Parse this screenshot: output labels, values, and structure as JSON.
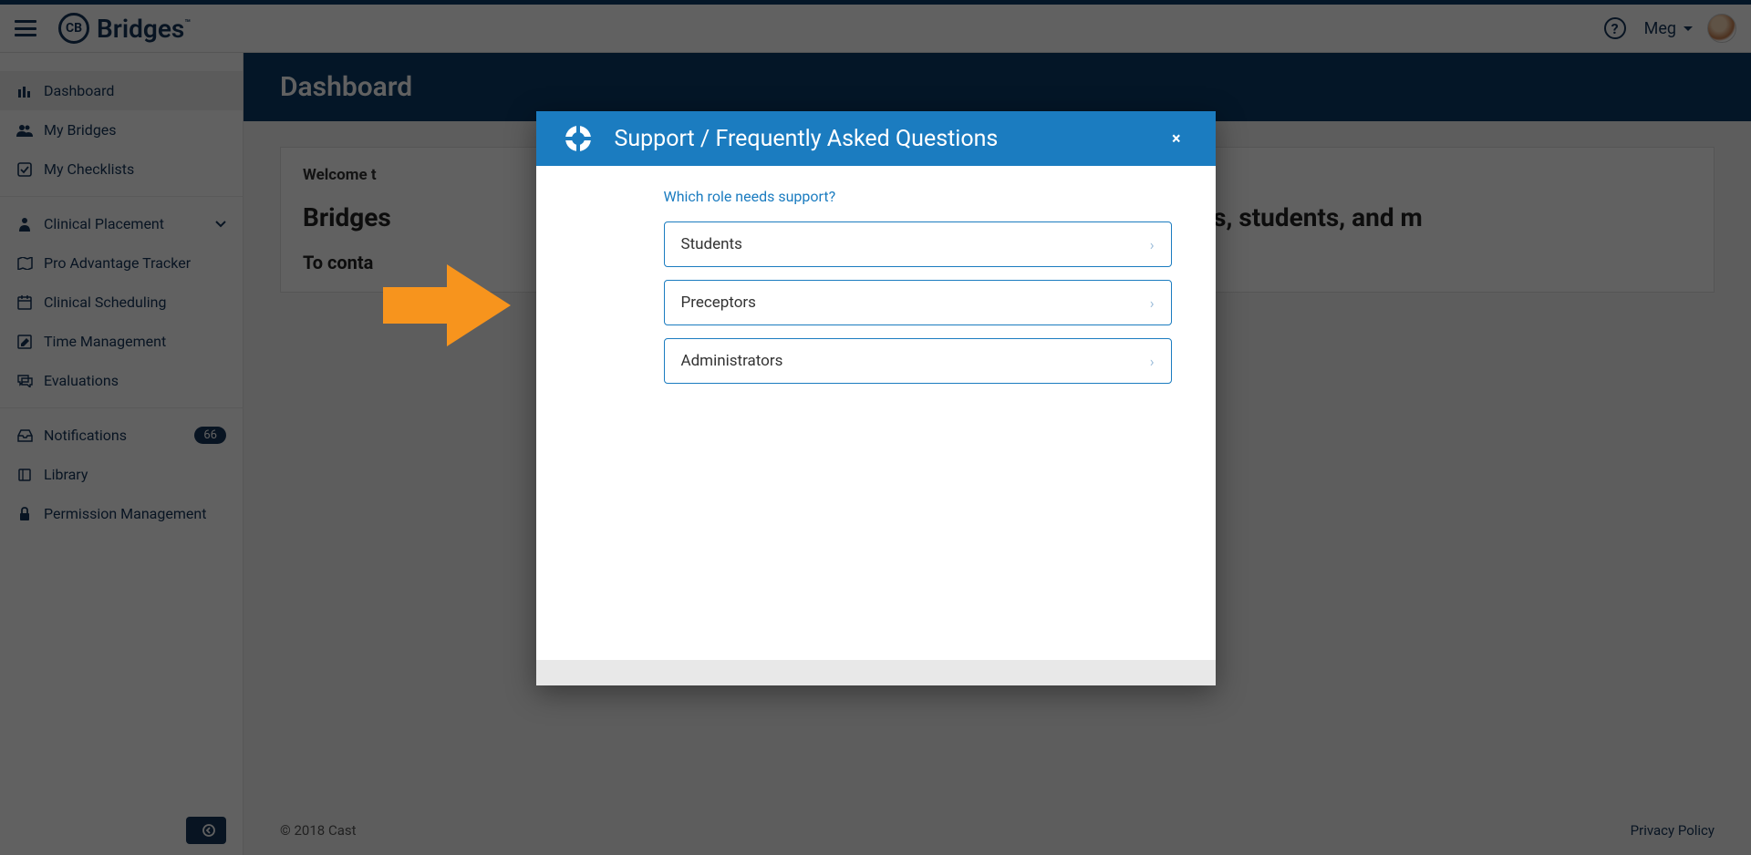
{
  "brand": {
    "logo_text": "CB",
    "name": "Bridges",
    "tm": "™"
  },
  "header": {
    "help_glyph": "?",
    "user_name": "Meg"
  },
  "sidebar": {
    "items": [
      {
        "label": "Dashboard"
      },
      {
        "label": "My Bridges"
      },
      {
        "label": "My Checklists"
      },
      {
        "label": "Clinical Placement"
      },
      {
        "label": "Pro Advantage Tracker"
      },
      {
        "label": "Clinical Scheduling"
      },
      {
        "label": "Time Management"
      },
      {
        "label": "Evaluations"
      },
      {
        "label": "Notifications",
        "badge": "66"
      },
      {
        "label": "Library"
      },
      {
        "label": "Permission Management"
      }
    ],
    "collapse_glyph": "←"
  },
  "page": {
    "title": "Dashboard",
    "welcome_prefix": "Welcome t",
    "headline_part1": "Bridges",
    "headline_part2": "o help schools, students, and m",
    "contact_prefix": "To conta"
  },
  "footer": {
    "copyright": "© 2018 Cast",
    "privacy": "Privacy Policy"
  },
  "modal": {
    "title": "Support / Frequently Asked Questions",
    "close_glyph": "×",
    "prompt": "Which role needs support?",
    "options": [
      {
        "label": "Students"
      },
      {
        "label": "Preceptors"
      },
      {
        "label": "Administrators"
      }
    ],
    "chevron_glyph": "›"
  }
}
